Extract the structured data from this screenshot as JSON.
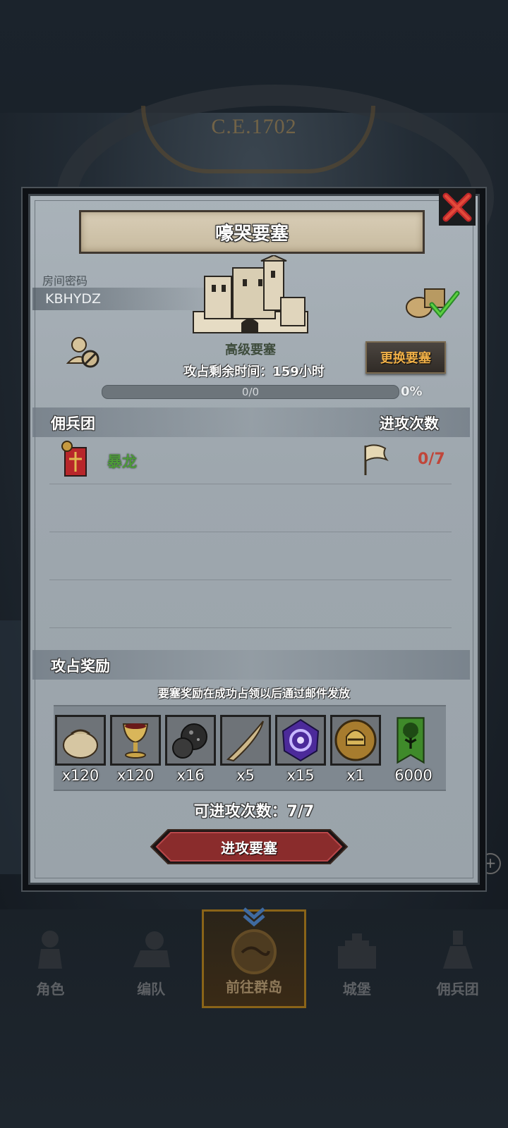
{
  "era": "C.E.1702",
  "dialog": {
    "title": "嚎哭要塞",
    "room_label": "房间密码",
    "room_code": "KBHYDZ",
    "fortress_name": "高级要塞",
    "change_button": "更换要塞",
    "time_remaining": "攻占剩余时间：159小时",
    "progress": {
      "text": "0/0",
      "percent_label": "0%",
      "value": 0
    },
    "roster": {
      "left_header": "佣兵团",
      "right_header": "进攻次数",
      "rows": [
        {
          "name": "暴龙",
          "attacks": "0/7"
        }
      ]
    },
    "rewards": {
      "header": "攻占奖励",
      "note": "要塞奖励在成功占领以后通过邮件发放",
      "items": [
        {
          "icon": "sack-icon",
          "qty": "x120"
        },
        {
          "icon": "goblet-icon",
          "qty": "x120"
        },
        {
          "icon": "ore-icon",
          "qty": "x16"
        },
        {
          "icon": "horn-icon",
          "qty": "x5"
        },
        {
          "icon": "rune-crystal-icon",
          "qty": "x15"
        },
        {
          "icon": "helmet-medal-icon",
          "qty": "x1"
        },
        {
          "icon": "tree-banner-icon",
          "qty": "6000"
        }
      ]
    },
    "attempts": "可进攻次数：7/7",
    "attack_button": "进攻要塞"
  },
  "nav": [
    {
      "label": "角色",
      "icon": "knight-icon"
    },
    {
      "label": "编队",
      "icon": "squad-icon"
    },
    {
      "label": "前往群岛",
      "icon": "islands-icon",
      "active": true
    },
    {
      "label": "城堡",
      "icon": "castle-icon"
    },
    {
      "label": "佣兵团",
      "icon": "mercenary-icon"
    }
  ],
  "colors": {
    "guild_name": "#4d9a38",
    "attack_count": "#c0463a",
    "change_button_text": "#f0b048",
    "attack_button": "#8a2c2c"
  }
}
